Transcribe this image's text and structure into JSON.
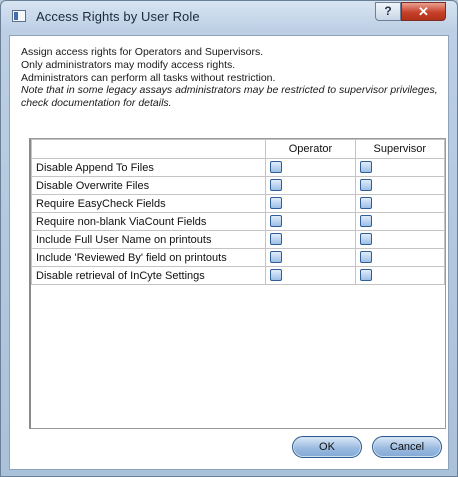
{
  "window": {
    "title": "Access Rights by User Role",
    "help_label": "?",
    "close_label": "✕"
  },
  "description": {
    "line1": "Assign access rights for Operators and Supervisors.",
    "line2": "Only administrators may modify access rights.",
    "line3": "Administrators can perform all tasks without restriction.",
    "note": "Note that in some legacy assays administrators may be restricted to supervisor privileges, check documentation for details."
  },
  "table": {
    "columns": [
      "Operator",
      "Supervisor"
    ],
    "rows": [
      {
        "label": "Disable Append To Files",
        "operator": false,
        "supervisor": false
      },
      {
        "label": "Disable Overwrite Files",
        "operator": false,
        "supervisor": false
      },
      {
        "label": "Require EasyCheck Fields",
        "operator": false,
        "supervisor": false
      },
      {
        "label": "Require non-blank ViaCount Fields",
        "operator": false,
        "supervisor": false
      },
      {
        "label": "Include Full User Name on printouts",
        "operator": false,
        "supervisor": false
      },
      {
        "label": "Include 'Reviewed By' field on printouts",
        "operator": false,
        "supervisor": false
      },
      {
        "label": "Disable retrieval of InCyte Settings",
        "operator": false,
        "supervisor": false
      }
    ]
  },
  "buttons": {
    "ok": "OK",
    "cancel": "Cancel"
  },
  "colors": {
    "titlebar": "#c4d5e8",
    "close": "#c7402a",
    "checkbox": "#9cc0e8"
  }
}
